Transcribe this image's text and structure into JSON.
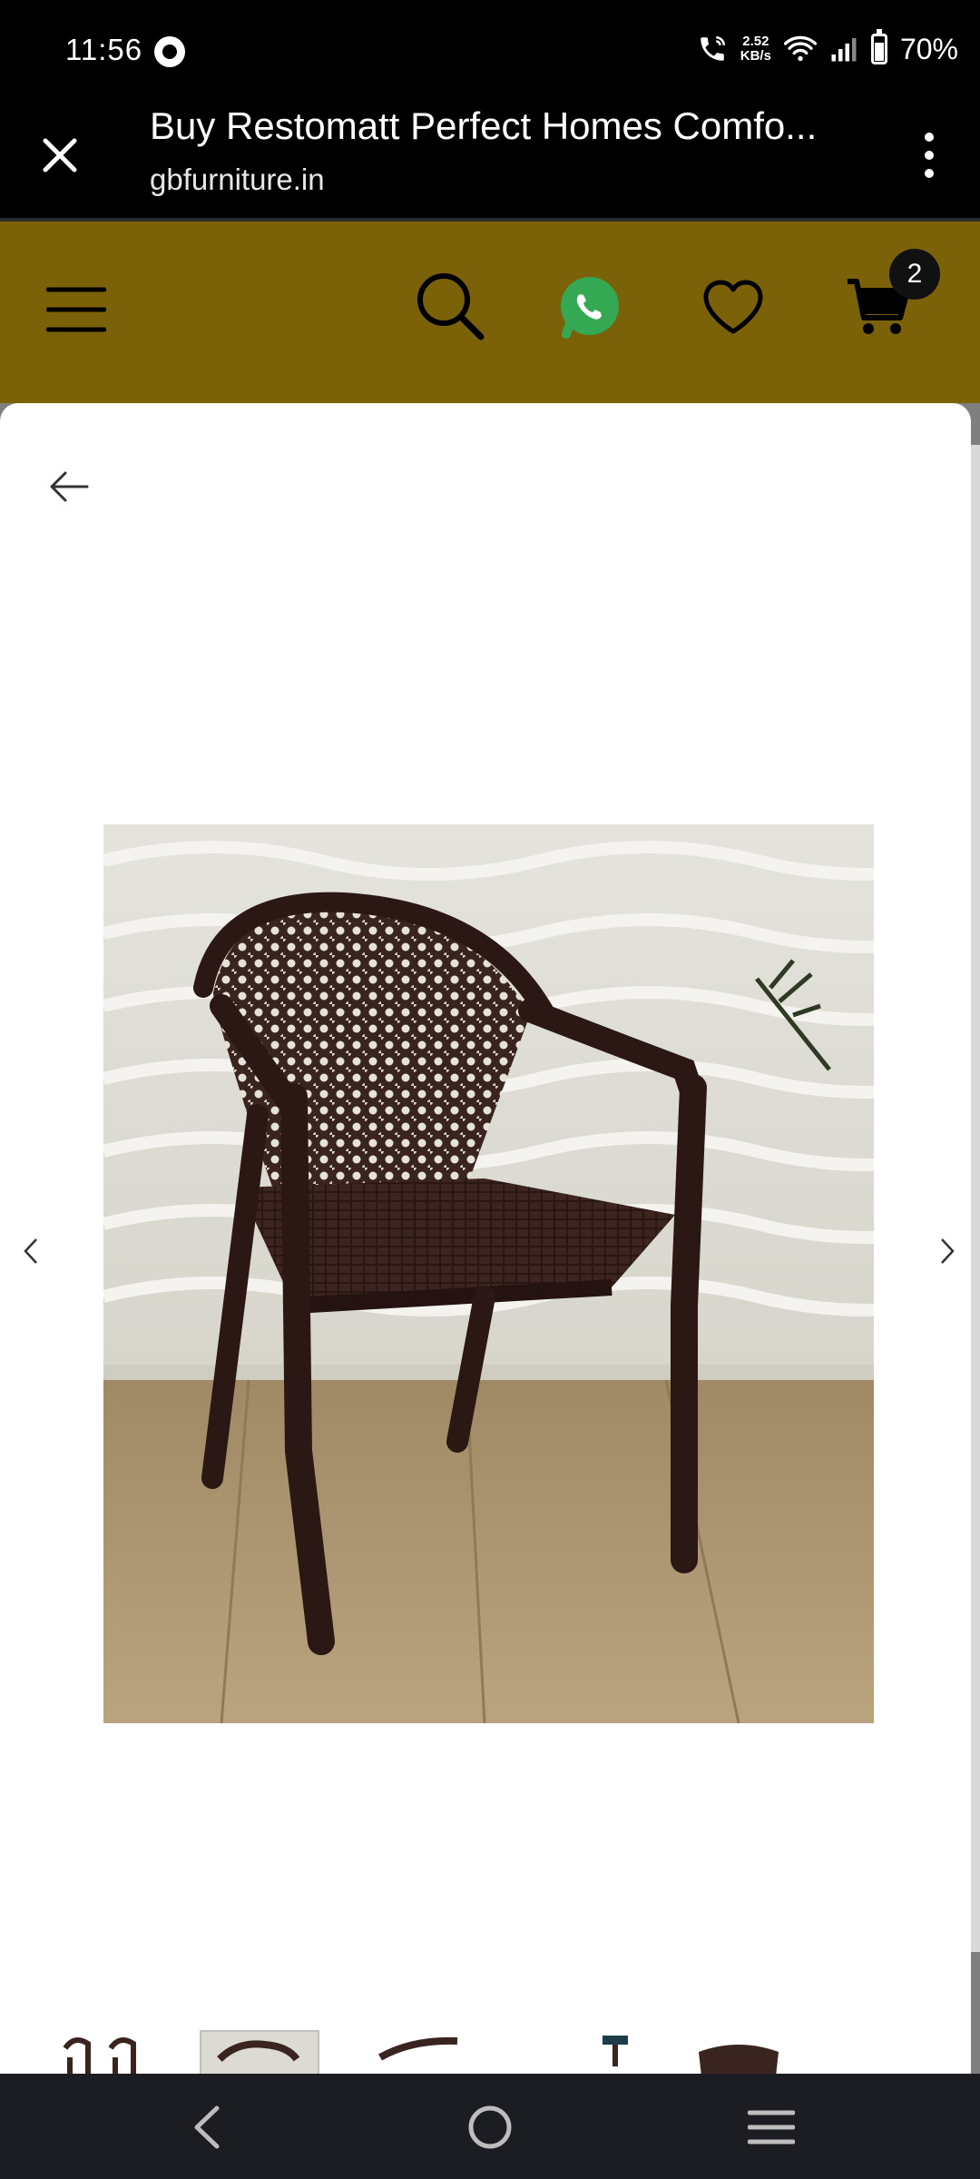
{
  "status_bar": {
    "time": "11:56",
    "net_speed_value": "2.52",
    "net_speed_unit": "KB/s",
    "battery": "70%"
  },
  "browser": {
    "page_title": "Buy Restomatt Perfect Homes Comfo...",
    "domain": "gbfurniture.in"
  },
  "site_nav": {
    "cart_count": "2",
    "icons": [
      "menu-icon",
      "search-icon",
      "whatsapp-icon",
      "heart-icon",
      "cart-icon"
    ],
    "accent_color": "#7b6208"
  },
  "gallery": {
    "image_subject": "brown plastic armchair",
    "thumbnail_count": 5,
    "active_thumbnail": 2
  }
}
